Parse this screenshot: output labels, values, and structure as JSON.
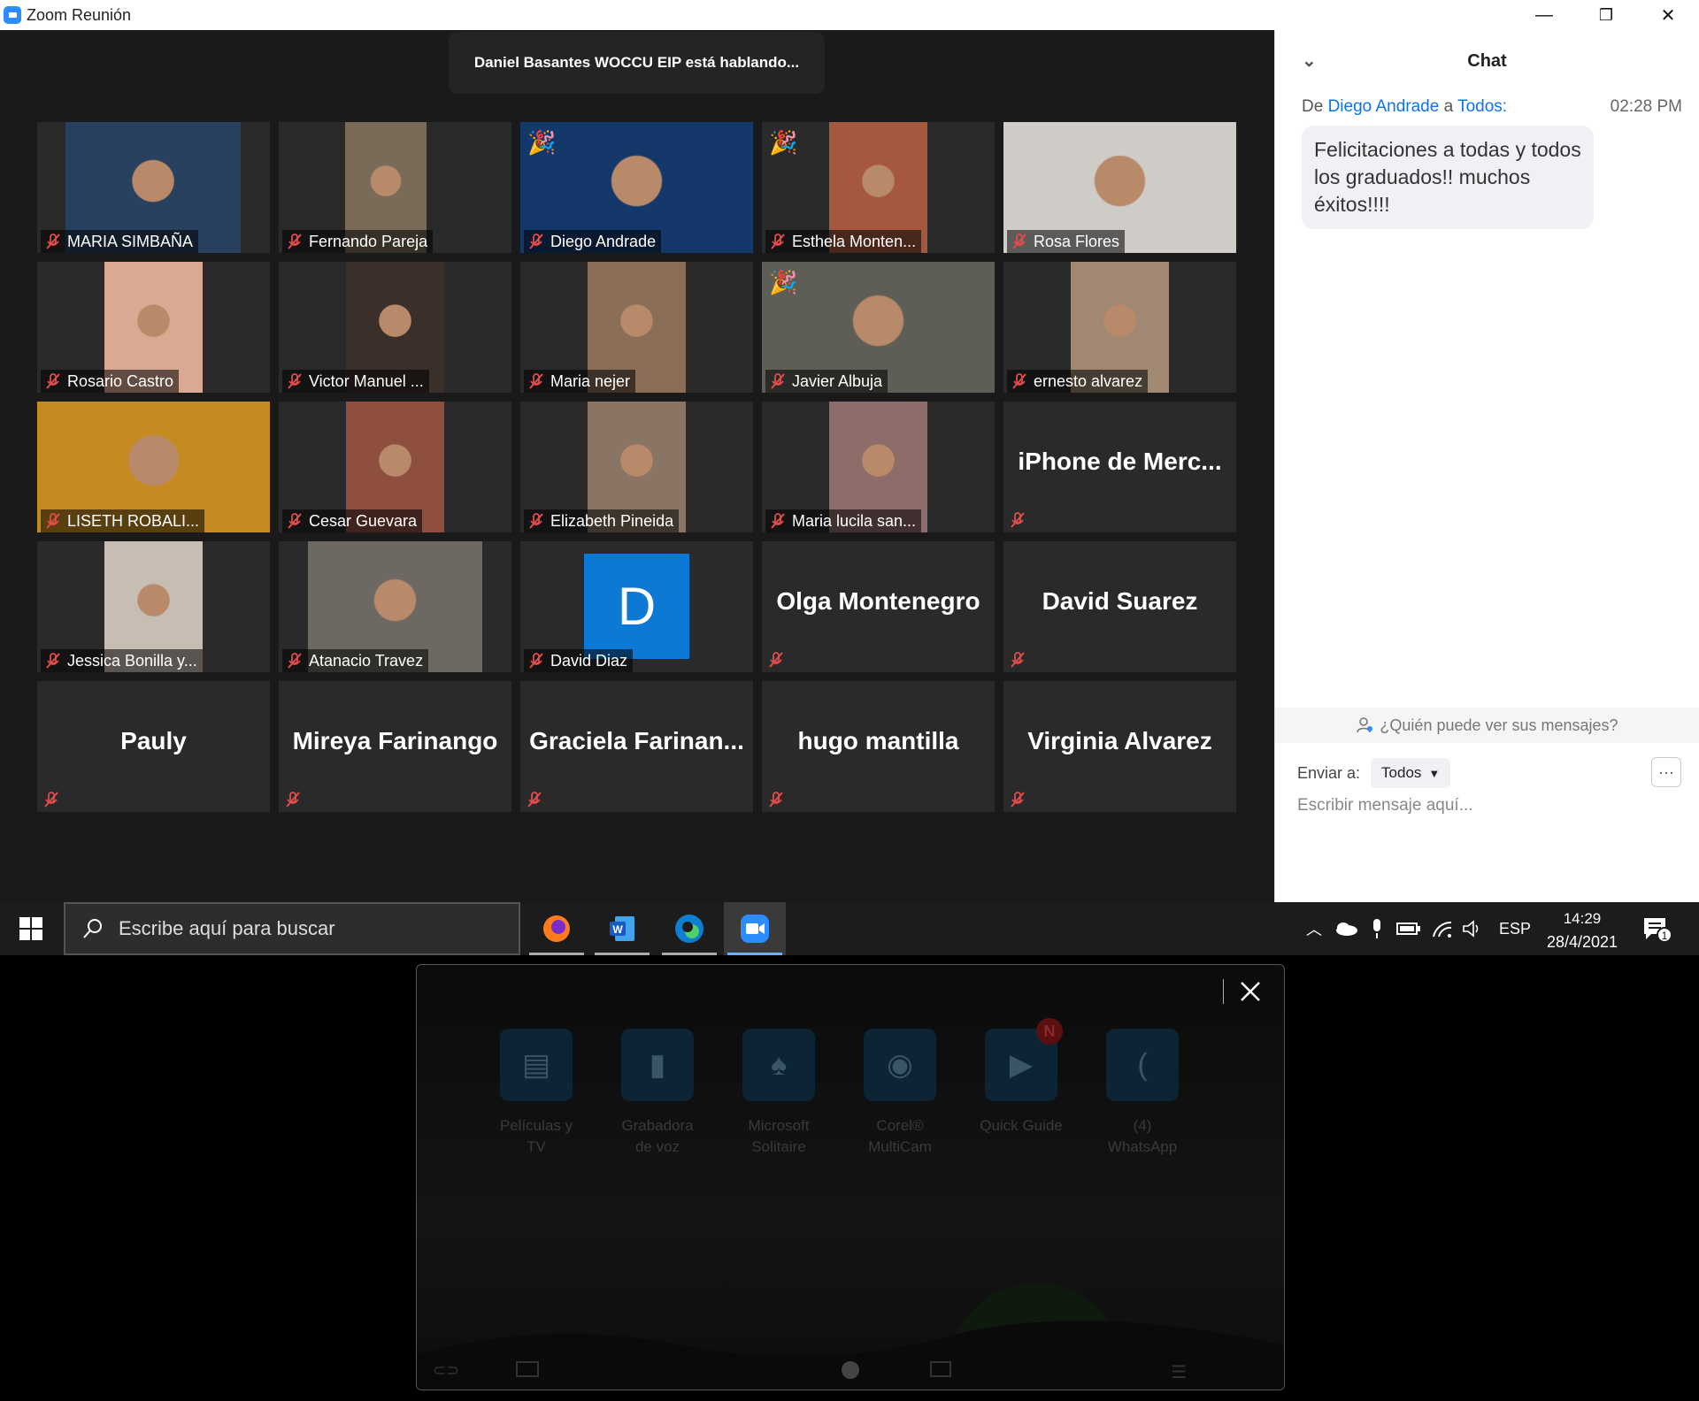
{
  "window": {
    "title": "Zoom Reunión",
    "controls": {
      "minimize": "—",
      "restore": "❐",
      "close": "✕"
    }
  },
  "meeting": {
    "speaker_banner": "Daniel Basantes WOCCU EIP está hablando...",
    "participants": [
      {
        "name": "MARIA SIMBAÑA",
        "video": true,
        "color": "#27415f"
      },
      {
        "name": "Fernando Pareja",
        "video": true,
        "color": "#7a6a58"
      },
      {
        "name": "Diego Andrade",
        "video": true,
        "color": "#15386a"
      },
      {
        "name": "Esthela Monten...",
        "video": true,
        "color": "#a5583e"
      },
      {
        "name": "Rosa Flores",
        "video": true,
        "color": "#cfcbc7"
      },
      {
        "name": "Rosario Castro",
        "video": true,
        "color": "#d9a993"
      },
      {
        "name": "Victor Manuel ...",
        "video": true,
        "color": "#3b2f2a"
      },
      {
        "name": "Maria nejer",
        "video": true,
        "color": "#8b6e58"
      },
      {
        "name": "Javier Albuja",
        "video": true,
        "color": "#5f5e56"
      },
      {
        "name": "ernesto alvarez",
        "video": true,
        "color": "#a08872"
      },
      {
        "name": "LISETH ROBALI...",
        "video": true,
        "color": "#c58a22"
      },
      {
        "name": "Cesar Guevara",
        "video": true,
        "color": "#8f4f3e"
      },
      {
        "name": "Elizabeth Pineida",
        "video": true,
        "color": "#8a7564"
      },
      {
        "name": "Maria lucila san...",
        "video": true,
        "color": "#8e6c6a"
      },
      {
        "name": "iPhone de Merc...",
        "video": false
      },
      {
        "name": "Jessica Bonilla y...",
        "video": true,
        "color": "#c8bdb3"
      },
      {
        "name": "Atanacio Travez",
        "video": true,
        "color": "#6d6861"
      },
      {
        "name": "David Diaz",
        "video": false,
        "avatar_letter": "D"
      },
      {
        "name": "Olga Montenegro",
        "video": false
      },
      {
        "name": "David Suarez",
        "video": false
      },
      {
        "name": "Pauly",
        "video": false
      },
      {
        "name": "Mireya Farinango",
        "video": false
      },
      {
        "name": "Graciela  Farinan...",
        "video": false
      },
      {
        "name": "hugo mantilla",
        "video": false
      },
      {
        "name": "Virginia Alvarez",
        "video": false
      }
    ]
  },
  "chat": {
    "title": "Chat",
    "message": {
      "prefix": "De",
      "sender": "Diego Andrade",
      "joiner": "a",
      "recipient": "Todos",
      "suffix": ":",
      "time": "02:28 PM",
      "text": "Felicitaciones a todas y todos los graduados!! muchos éxitos!!!!"
    },
    "who_can_see": "¿Quién puede ver sus mensajes?",
    "send_to_label": "Enviar a:",
    "send_to_value": "Todos",
    "more_label": "···",
    "input_placeholder": "Escribir mensaje aquí..."
  },
  "taskbar": {
    "search_placeholder": "Escribe aquí para buscar",
    "apps": [
      "firefox",
      "word",
      "edge",
      "zoom"
    ],
    "language": "ESP",
    "time": "14:29",
    "date": "28/4/2021",
    "notification_count": "1"
  },
  "overlay": {
    "apps": [
      {
        "line1": "Películas y",
        "line2": "TV"
      },
      {
        "line1": "Grabadora",
        "line2": "de voz"
      },
      {
        "line1": "Microsoft",
        "line2": "Solitaire"
      },
      {
        "line1": "Corel®",
        "line2": "MultiCam"
      },
      {
        "line1": "Quick Guide",
        "line2": "",
        "badge": "N"
      },
      {
        "line1": "(4)",
        "line2": "WhatsApp"
      }
    ]
  }
}
